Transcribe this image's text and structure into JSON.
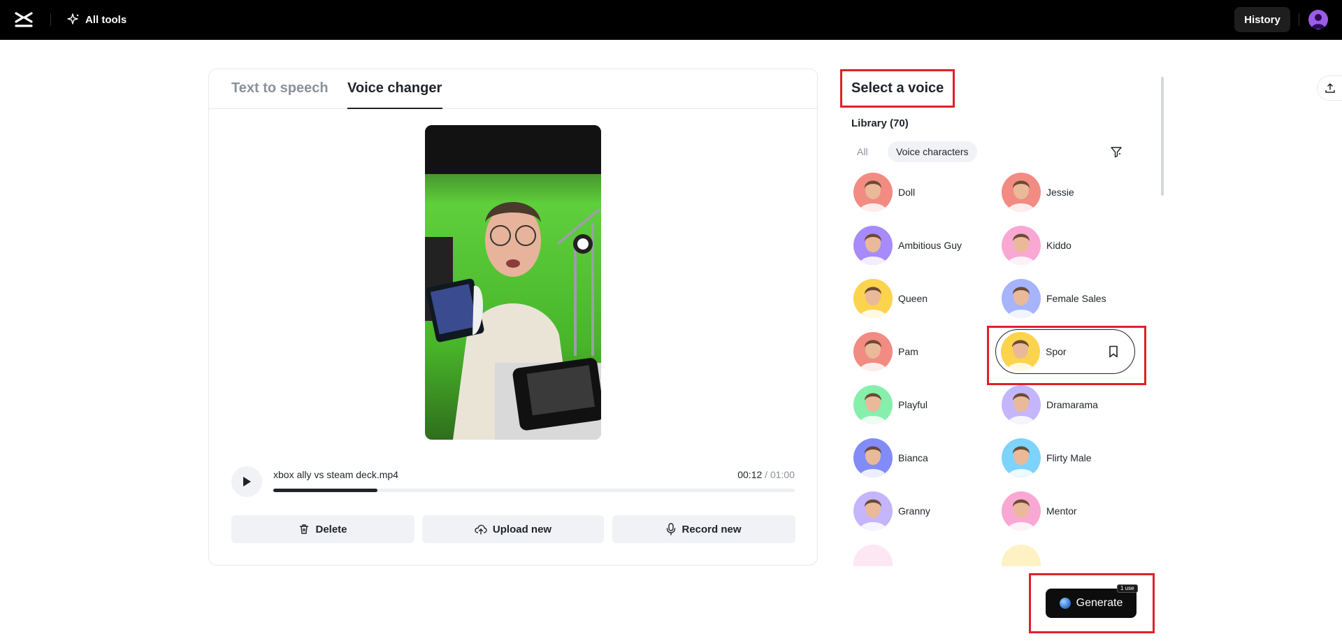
{
  "topbar": {
    "all_tools": "All tools",
    "history": "History"
  },
  "tabs": {
    "text_to_speech": "Text to speech",
    "voice_changer": "Voice changer"
  },
  "player": {
    "file_name": "xbox ally vs steam deck.mp4",
    "current_time": "00:12",
    "separator": " / ",
    "total_time": "01:00",
    "progress_fraction": 0.2
  },
  "actions": {
    "delete": "Delete",
    "upload": "Upload new",
    "record": "Record new"
  },
  "voice_panel": {
    "title": "Select a voice",
    "library": "Library (70)",
    "filter_all": "All",
    "filter_characters": "Voice characters",
    "voices": [
      {
        "name": "Doll",
        "bg": "#f28b82"
      },
      {
        "name": "Jessie",
        "bg": "#f28b82"
      },
      {
        "name": "Ambitious Guy",
        "bg": "#a78bfa"
      },
      {
        "name": "Kiddo",
        "bg": "#f9a8d4"
      },
      {
        "name": "Queen",
        "bg": "#fcd34d"
      },
      {
        "name": "Female Sales",
        "bg": "#a5b4fc"
      },
      {
        "name": "Pam",
        "bg": "#f28b82"
      },
      {
        "name": "Spor",
        "bg": "#fcd34d"
      },
      {
        "name": "Playful",
        "bg": "#86efac"
      },
      {
        "name": "Dramarama",
        "bg": "#c4b5fd"
      },
      {
        "name": "Bianca",
        "bg": "#818cf8"
      },
      {
        "name": "Flirty Male",
        "bg": "#7dd3fc"
      },
      {
        "name": "Granny",
        "bg": "#c4b5fd"
      },
      {
        "name": "Mentor",
        "bg": "#f9a8d4"
      }
    ]
  },
  "generate": {
    "label": "Generate",
    "badge": "1 use"
  }
}
